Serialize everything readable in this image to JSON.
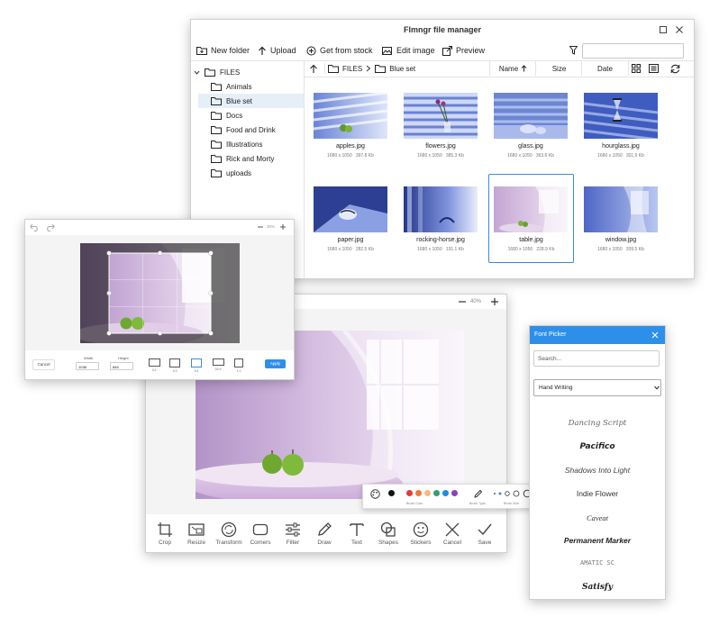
{
  "file_manager": {
    "title": "Flmngr file manager",
    "toolbar": {
      "new_folder": "New folder",
      "upload": "Upload",
      "get_from_stock": "Get from stock",
      "edit_image": "Edit image",
      "preview": "Preview"
    },
    "tree": {
      "root": "FILES",
      "items": [
        "Animals",
        "Blue set",
        "Docs",
        "Food and Drink",
        "Illustrations",
        "Rick and Morty",
        "uploads"
      ],
      "selected": "Blue set"
    },
    "path": {
      "root": "FILES",
      "current": "Blue set"
    },
    "sort": {
      "name": "Name",
      "size": "Size",
      "date": "Date"
    },
    "files": [
      {
        "name": "apples.jpg",
        "dims": "1680 x 1050",
        "size": "397.8 Kb"
      },
      {
        "name": "flowers.jpg",
        "dims": "1680 x 1050",
        "size": "385.3 Kb"
      },
      {
        "name": "glass.jpg",
        "dims": "1680 x 1050",
        "size": "363.6 Kb"
      },
      {
        "name": "hourglass.jpg",
        "dims": "1680 x 1050",
        "size": "301.9 Kb"
      },
      {
        "name": "paper.jpg",
        "dims": "1680 x 1050",
        "size": "282.5 Kb"
      },
      {
        "name": "rocking-horse.jpg",
        "dims": "1680 x 1050",
        "size": "191.1 Kb"
      },
      {
        "name": "table.jpg",
        "dims": "1680 x 1050",
        "size": "228.9 Kb"
      },
      {
        "name": "window.jpg",
        "dims": "1680 x 1050",
        "size": "209.5 Kb"
      }
    ],
    "selected_file": "table.jpg"
  },
  "editor": {
    "zoom": "40%",
    "tools": [
      "Crop",
      "Resize",
      "Transform",
      "Corners",
      "Filter",
      "Draw",
      "Text",
      "Shapes",
      "Stickers",
      "Cancel",
      "Save"
    ]
  },
  "brush": {
    "colors": [
      "#111111",
      "#e53935",
      "#f4763a",
      "#f7b983",
      "#2e9e7a",
      "#1e88e5",
      "#8e3fbf"
    ],
    "color_label": "Brush Color",
    "type_label": "Brush Type",
    "size_label": "Brush Size"
  },
  "crop_dialog": {
    "zoom": "30%",
    "cancel": "Cancel",
    "width_label": "Width",
    "width_value": "1038",
    "height_label": "Height",
    "height_value": "846",
    "ratios": [
      "3:2",
      "4:3",
      "5:4",
      "16:9",
      "1:1"
    ],
    "selected_ratio": "5:4",
    "apply": "Apply"
  },
  "font_picker": {
    "title": "Font Picker",
    "search_placeholder": "Search...",
    "category": "Hand Writing",
    "fonts": [
      "Dancing Script",
      "Pacifico",
      "Shadows Into Light",
      "Indie Flower",
      "Caveat",
      "Permanent Marker",
      "Amatic SC",
      "Satisfy"
    ]
  },
  "colors": {
    "accent": "#2e8fe8",
    "selection": "#3b8bd8"
  }
}
